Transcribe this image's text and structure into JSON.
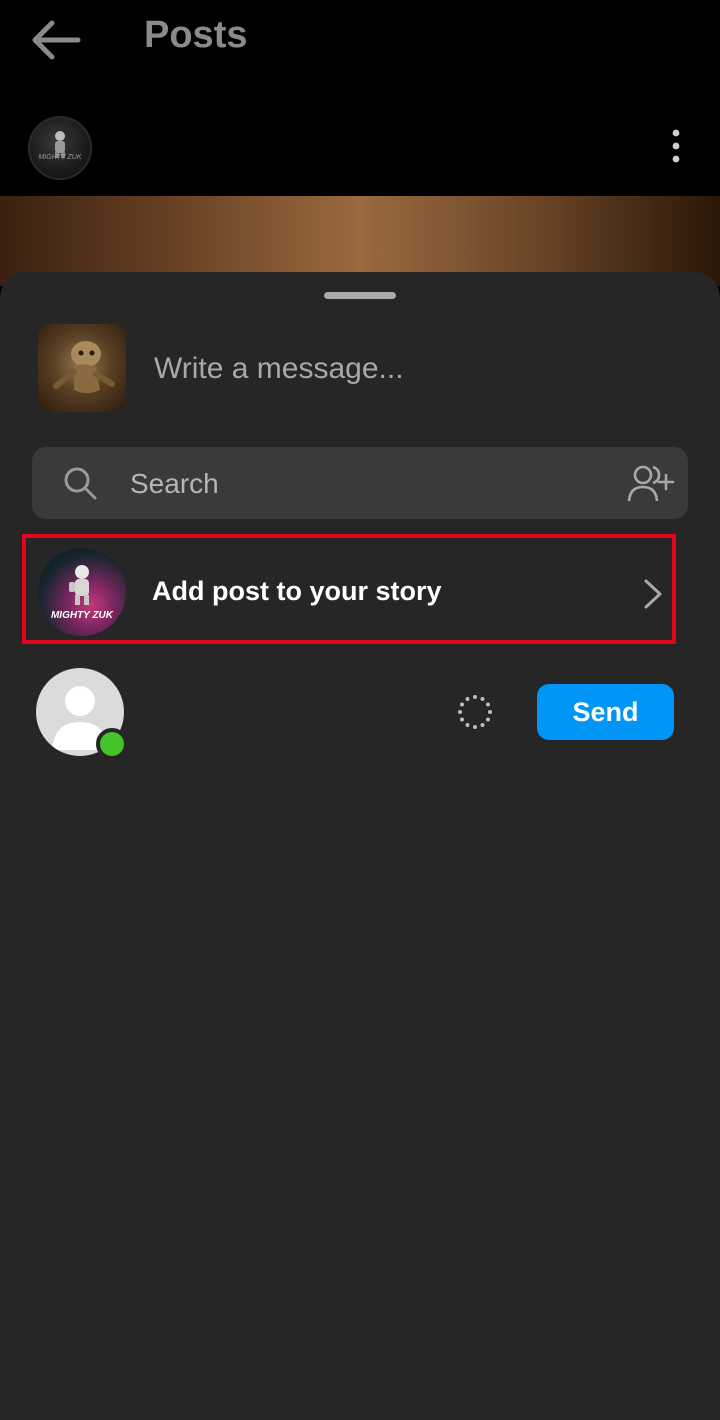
{
  "header": {
    "title": "Posts"
  },
  "post": {
    "avatar_text": "MIGHTY ZUK"
  },
  "share_sheet": {
    "message_placeholder": "Write a message...",
    "search_placeholder": "Search",
    "story_row": {
      "label": "Add post to your story",
      "avatar_text": "MIGHTY ZUK"
    },
    "contact": {
      "online": true,
      "send_label": "Send"
    }
  },
  "colors": {
    "sheet_bg": "#262626",
    "search_bg": "#3a3a3a",
    "send_button": "#0095f6",
    "highlight_border": "#e0061b",
    "online_dot": "#46c22a"
  },
  "icons": {
    "back": "arrow-left-icon",
    "more": "vertical-dots-icon",
    "search": "search-icon",
    "add_people": "add-people-icon",
    "chevron": "chevron-right-icon",
    "loading": "loading-spinner-icon"
  }
}
